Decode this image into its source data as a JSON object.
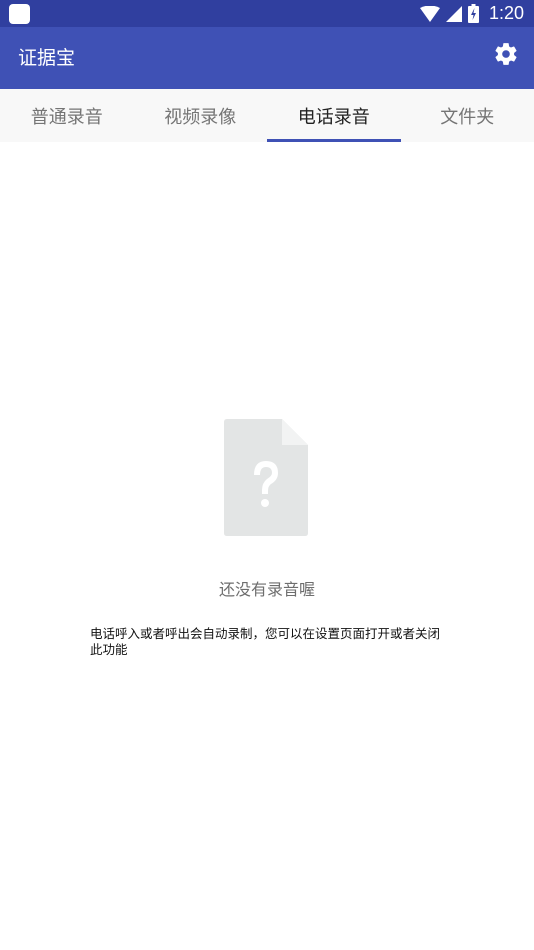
{
  "status_bar": {
    "time": "1:20",
    "icons": [
      "app-notification-icon",
      "wifi-icon",
      "cell-signal-icon",
      "battery-charging-icon"
    ]
  },
  "app_bar": {
    "title": "证据宝",
    "settings_icon": "gear-icon"
  },
  "tabs": [
    {
      "label": "普通录音",
      "active": false
    },
    {
      "label": "视频录像",
      "active": false
    },
    {
      "label": "电话录音",
      "active": true
    },
    {
      "label": "文件夹",
      "active": false
    }
  ],
  "empty_state": {
    "icon": "unknown-file-icon",
    "title": "还没有录音喔",
    "hint": "电话呼入或者呼出会自动录制，您可以在设置页面打开或者关闭此功能"
  },
  "colors": {
    "status_bar": "#303f9f",
    "app_bar": "#3f51b5",
    "tab_indicator": "#3f51b5",
    "tab_bar_bg": "#f8f8f8",
    "empty_icon": "#e3e5e5"
  }
}
